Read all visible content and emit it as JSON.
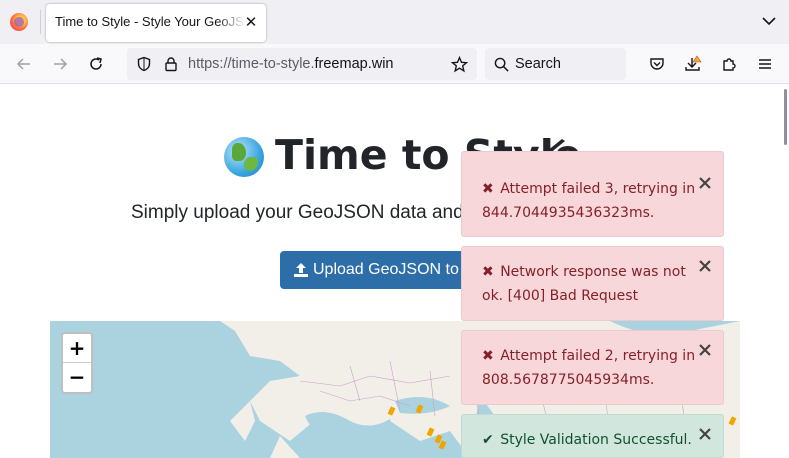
{
  "browser": {
    "tab_title": "Time to Style - Style Your GeoJSON",
    "tab_close": "✕",
    "url_prefix": "https://time-to-style.",
    "url_domain": "freemap.win",
    "search_label": "Search"
  },
  "page": {
    "title": "Time to Style",
    "subtitle": "Simply upload your GeoJSON data and",
    "upload_label": "Upload GeoJSON to Style"
  },
  "map": {
    "zoom_in": "+",
    "zoom_out": "−"
  },
  "toasts": [
    {
      "type": "error",
      "icon": "✖",
      "message": "Attempt failed 3, retrying in 844.7044935436323ms."
    },
    {
      "type": "error",
      "icon": "✖",
      "message": "Network response was not ok. [400] Bad Request"
    },
    {
      "type": "error",
      "icon": "✖",
      "message": "Attempt failed 2, retrying in 808.5678775045934ms."
    },
    {
      "type": "success",
      "icon": "✔",
      "message": "Style Validation Successful."
    }
  ],
  "colors": {
    "error_bg": "#f8d7da",
    "error_text": "#842029",
    "success_bg": "#d1e7dd",
    "success_text": "#0f5132",
    "button_bg": "#2d6ea8"
  }
}
